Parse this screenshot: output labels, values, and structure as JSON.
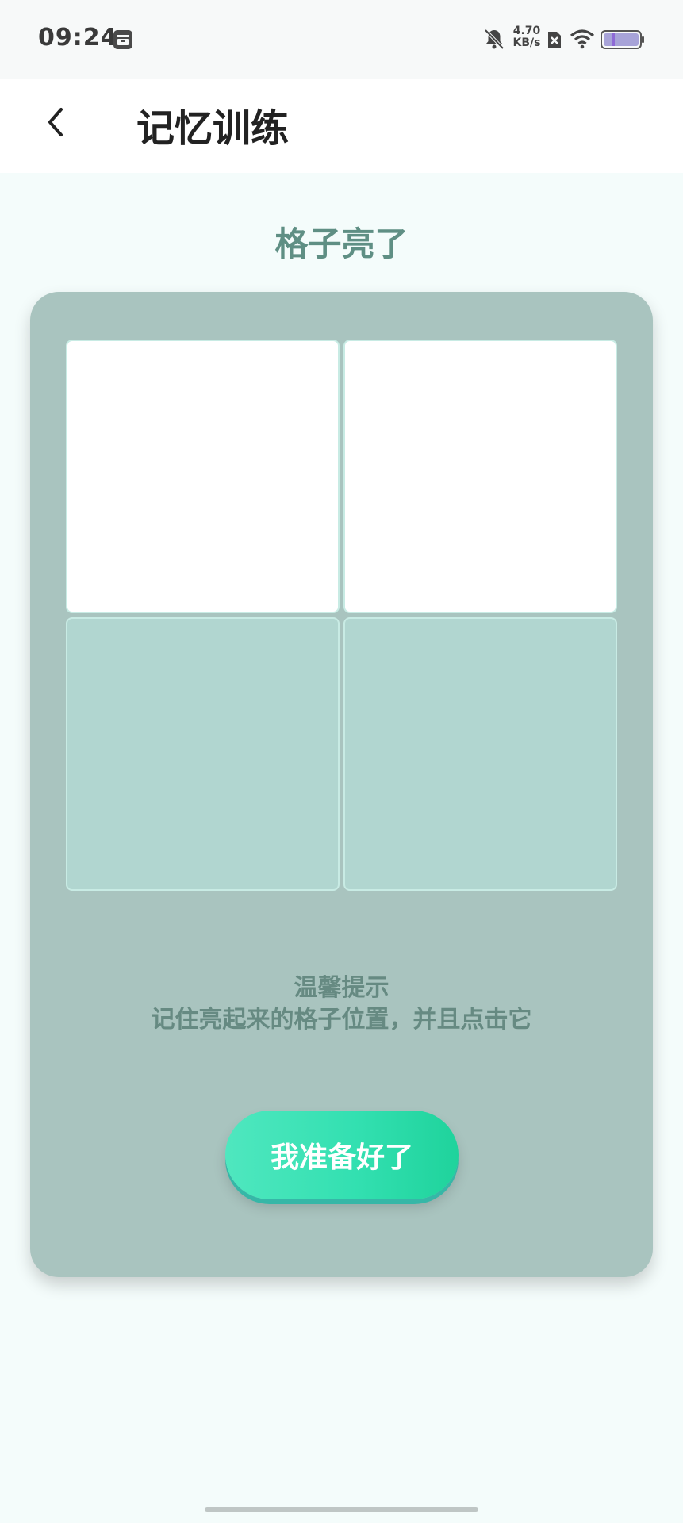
{
  "status_bar": {
    "time": "09:24",
    "net_speed_value": "4.70",
    "net_speed_unit": "KB/s",
    "icons": [
      "app-notification-icon",
      "mute-bell-icon",
      "sim-disabled-icon",
      "wifi-icon",
      "battery-icon"
    ]
  },
  "header": {
    "title": "记忆训练",
    "back_icon": "chevron-left-icon"
  },
  "game": {
    "state_title": "格子亮了",
    "cells": [
      {
        "state": "lit"
      },
      {
        "state": "lit"
      },
      {
        "state": "dim"
      },
      {
        "state": "dim"
      }
    ],
    "tip_title": "温馨提示",
    "tip_text": "记住亮起来的格子位置，并且点击它",
    "ready_button_label": "我准备好了"
  },
  "colors": {
    "page_background": "#f4fcfb",
    "card_background": "#a9c4bf",
    "lit_cell": "#ffffff",
    "dim_cell": "#b1d6d0",
    "accent_green": "#33e0b1",
    "title_text": "#5f8f84"
  }
}
